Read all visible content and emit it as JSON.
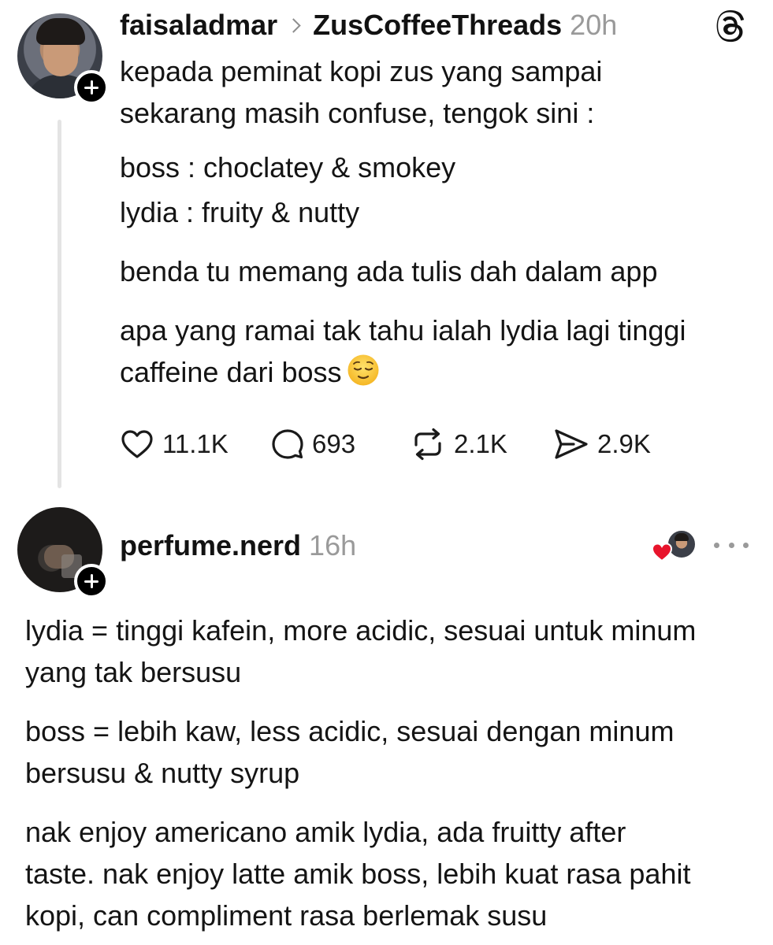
{
  "post1": {
    "username": "faisaladmar",
    "community": "ZusCoffeeThreads",
    "timestamp": "20h",
    "paragraphs": {
      "p1_line1": "kepada peminat kopi zus yang sampai",
      "p1_line2": "sekarang masih confuse, tengok sini :",
      "p2": "boss : choclatey & smokey",
      "p3": "lydia : fruity & nutty",
      "p4": "benda tu memang ada tulis dah dalam app",
      "p5_line1": "apa yang ramai tak tahu ialah lydia lagi tinggi",
      "p5_line2": "caffeine dari boss"
    },
    "stats": {
      "likes": "11.1K",
      "replies": "693",
      "reposts": "2.1K",
      "shares": "2.9K"
    },
    "icons": {
      "like": "heart-outline-icon",
      "reply": "speech-bubble-icon",
      "repost": "repost-arrows-icon",
      "share": "send-icon",
      "emoji": "relieved-face-emoji",
      "logo": "threads-logo-icon"
    }
  },
  "post2": {
    "username": "perfume.nerd",
    "timestamp": "16h",
    "paragraphs": {
      "p1_line1": "lydia = tinggi kafein, more acidic, sesuai untuk minum",
      "p1_line2": "yang tak bersusu",
      "p2_line1": "boss = lebih kaw, less acidic, sesuai dengan minum",
      "p2_line2": "bersusu & nutty syrup",
      "p3_line1": "nak enjoy americano amik lydia, ada fruitty after",
      "p3_line2": "taste. nak enjoy latte amik boss, lebih kuat rasa pahit",
      "p3_line3": "kopi, can compliment rasa berlemak susu"
    },
    "icons": {
      "liked_by": "liked-by-author-badge",
      "more": "more-dots-icon"
    }
  },
  "colors": {
    "text": "#141414",
    "muted": "#9a9a9a",
    "thread_line": "#e4e4e4",
    "heart_red": "#e8142c",
    "background": "#ffffff"
  }
}
